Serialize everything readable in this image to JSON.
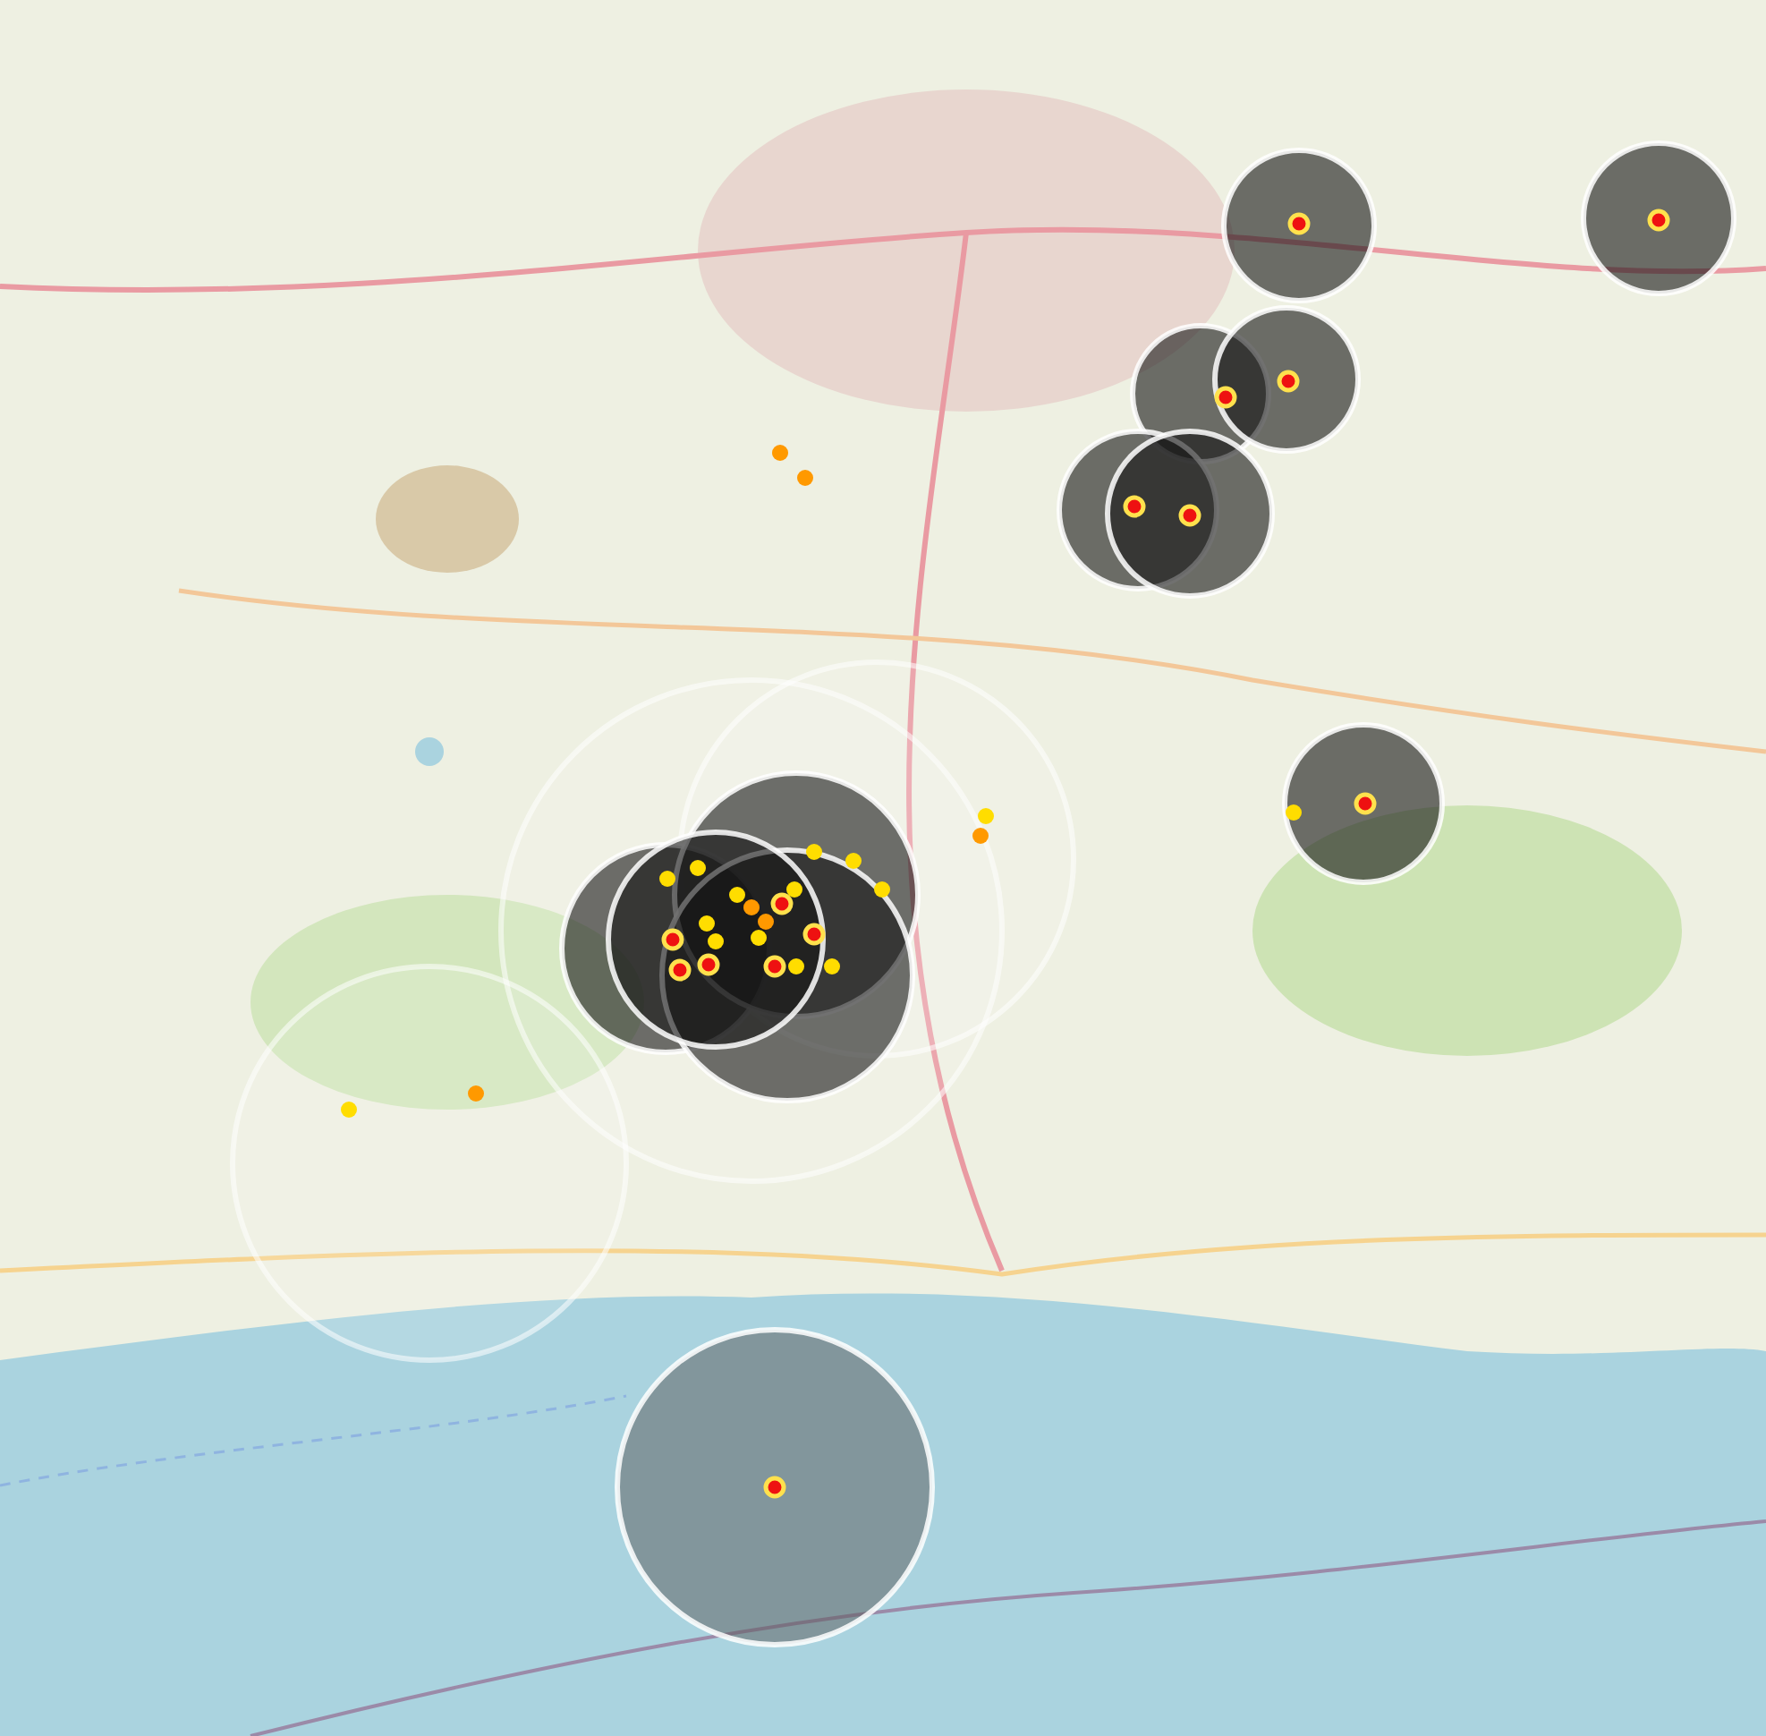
{
  "zones": [
    {
      "kind": "faint"
    },
    {
      "kind": "faint"
    },
    {
      "kind": "faint"
    },
    {
      "kind": "dark"
    },
    {
      "kind": "dark"
    },
    {
      "kind": "dark"
    },
    {
      "kind": "dark"
    },
    {
      "kind": "dark"
    },
    {
      "kind": "dark"
    },
    {
      "kind": "dark"
    },
    {
      "kind": "dark"
    },
    {
      "kind": "dark"
    },
    {
      "kind": "dark"
    },
    {
      "kind": "dark"
    },
    {
      "kind": "sea"
    }
  ],
  "markers": [
    {
      "kind": "large",
      "color": "#ee1111"
    },
    {
      "kind": "large",
      "color": "#ee1111"
    },
    {
      "kind": "large",
      "color": "#ee1111"
    },
    {
      "kind": "large",
      "color": "#ee1111"
    },
    {
      "kind": "large",
      "color": "#ee1111"
    },
    {
      "kind": "large",
      "color": "#ee1111"
    },
    {
      "kind": "large",
      "color": "#ee1111"
    },
    {
      "kind": "large",
      "color": "#ee1111"
    },
    {
      "kind": "large",
      "color": "#ee1111"
    },
    {
      "kind": "large",
      "color": "#ee1111"
    },
    {
      "kind": "large",
      "color": "#ee1111"
    },
    {
      "kind": "large",
      "color": "#ee1111"
    },
    {
      "kind": "large",
      "color": "#ee1111"
    },
    {
      "kind": "large",
      "color": "#ee1111"
    },
    {
      "kind": "small",
      "color": "#ffdd00"
    },
    {
      "kind": "small",
      "color": "#ffdd00"
    },
    {
      "kind": "small",
      "color": "#ffdd00"
    },
    {
      "kind": "small",
      "color": "#ffdd00"
    },
    {
      "kind": "small",
      "color": "#ffdd00"
    },
    {
      "kind": "small",
      "color": "#ffdd00"
    },
    {
      "kind": "small",
      "color": "#ffdd00"
    },
    {
      "kind": "small",
      "color": "#ffdd00"
    },
    {
      "kind": "small",
      "color": "#ffdd00"
    },
    {
      "kind": "small",
      "color": "#ffdd00"
    },
    {
      "kind": "small",
      "color": "#ffdd00"
    },
    {
      "kind": "small",
      "color": "#ffdd00"
    },
    {
      "kind": "small",
      "color": "#ffdd00"
    },
    {
      "kind": "small",
      "color": "#ffdd00"
    },
    {
      "kind": "small",
      "color": "#ffdd00"
    },
    {
      "kind": "small",
      "color": "#ff9900"
    },
    {
      "kind": "small",
      "color": "#ff9900"
    },
    {
      "kind": "small",
      "color": "#ff9900"
    },
    {
      "kind": "small",
      "color": "#ff9900"
    },
    {
      "kind": "small",
      "color": "#ff9900"
    },
    {
      "kind": "small",
      "color": "#ff9900"
    }
  ]
}
